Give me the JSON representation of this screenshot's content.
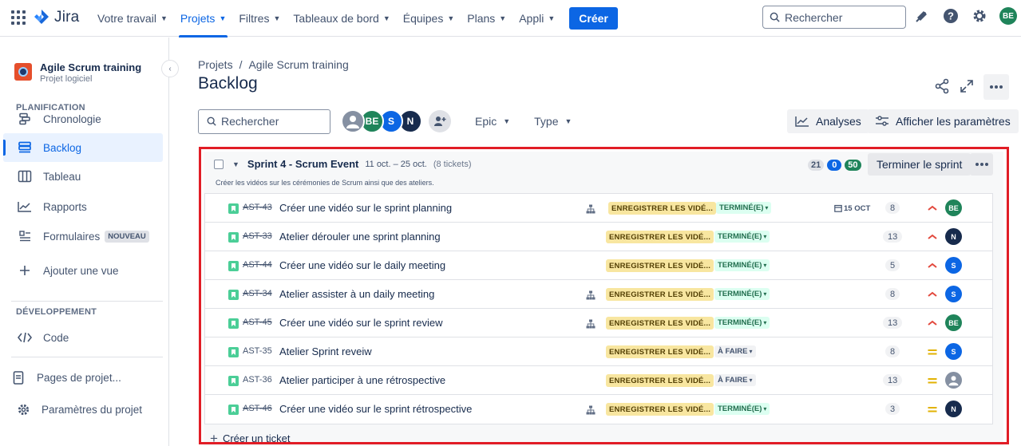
{
  "topnav": {
    "product": "Jira",
    "items": [
      {
        "label": "Votre travail",
        "active": false
      },
      {
        "label": "Projets",
        "active": true
      },
      {
        "label": "Filtres",
        "active": false
      },
      {
        "label": "Tableaux de bord",
        "active": false
      },
      {
        "label": "Équipes",
        "active": false
      },
      {
        "label": "Plans",
        "active": false
      },
      {
        "label": "Appli",
        "active": false
      }
    ],
    "create_label": "Créer",
    "search_placeholder": "Rechercher",
    "user_initials": "BE",
    "icons": [
      "app-switcher-icon",
      "notifications-icon",
      "help-icon",
      "settings-icon"
    ]
  },
  "sidebar": {
    "project_name": "Agile Scrum training",
    "project_type": "Projet logiciel",
    "planning_label": "PLANIFICATION",
    "items": [
      {
        "label": "Chronologie",
        "icon": "timeline-icon"
      },
      {
        "label": "Backlog",
        "icon": "backlog-icon",
        "active": true
      },
      {
        "label": "Tableau",
        "icon": "board-icon"
      },
      {
        "label": "Rapports",
        "icon": "reports-icon"
      },
      {
        "label": "Formulaires",
        "icon": "forms-icon",
        "badge": "NOUVEAU"
      },
      {
        "label": "Ajouter une vue",
        "icon": "plus-icon"
      }
    ],
    "dev_label": "DÉVELOPPEMENT",
    "code_label": "Code",
    "pages_label": "Pages de projet...",
    "settings_label": "Paramètres du projet"
  },
  "page": {
    "breadcrumb": [
      "Projets",
      "Agile Scrum training"
    ],
    "breadcrumb_sep": "/",
    "title": "Backlog"
  },
  "filters": {
    "search_placeholder": "Rechercher",
    "avatars": [
      {
        "initials": "",
        "color": "#8590a2"
      },
      {
        "initials": "BE",
        "color": "#1f845a"
      },
      {
        "initials": "S",
        "color": "#0c66e4"
      },
      {
        "initials": "N",
        "color": "#172b4d"
      }
    ],
    "epic_label": "Epic",
    "type_label": "Type",
    "insights_label": "Analyses",
    "view_settings_label": "Afficher les paramètres"
  },
  "sprint": {
    "name": "Sprint 4 - Scrum Event",
    "dates": "11 oct. – 25 oct.",
    "ticket_count": "(8 tickets)",
    "goal": "Créer les vidéos sur les cérémonies de Scrum ainsi que des ateliers.",
    "points_todo": "21",
    "points_in_progress": "0",
    "points_done": "50",
    "finish_label": "Terminer le sprint",
    "create_ticket_label": "Créer un ticket",
    "colors": {
      "frame": "#e11d26",
      "done_status": "#216e4e",
      "epic": "#f8e6a0"
    },
    "issues": [
      {
        "key": "AST-43",
        "summary": "Créer une vidéo sur le sprint planning",
        "has_children": true,
        "epic": "ENREGISTRER LES VIDÉ...",
        "status": "TERMINÉ(E)",
        "status_type": "done",
        "due": "15 OCT",
        "points": "8",
        "priority": "high",
        "assignee": "BE",
        "assignee_color": "#1f845a"
      },
      {
        "key": "AST-33",
        "summary": "Atelier dérouler une sprint planning",
        "has_children": false,
        "epic": "ENREGISTRER LES VIDÉ...",
        "status": "TERMINÉ(E)",
        "status_type": "done",
        "due": "",
        "points": "13",
        "priority": "high",
        "assignee": "N",
        "assignee_color": "#172b4d"
      },
      {
        "key": "AST-44",
        "summary": "Créer une vidéo sur le daily meeting",
        "has_children": false,
        "epic": "ENREGISTRER LES VIDÉ...",
        "status": "TERMINÉ(E)",
        "status_type": "done",
        "due": "",
        "points": "5",
        "priority": "high",
        "assignee": "S",
        "assignee_color": "#0c66e4"
      },
      {
        "key": "AST-34",
        "summary": "Atelier assister à un daily meeting",
        "has_children": true,
        "epic": "ENREGISTRER LES VIDÉ...",
        "status": "TERMINÉ(E)",
        "status_type": "done",
        "due": "",
        "points": "8",
        "priority": "high",
        "assignee": "S",
        "assignee_color": "#0c66e4"
      },
      {
        "key": "AST-45",
        "summary": "Créer une vidéo sur le sprint review",
        "has_children": true,
        "epic": "ENREGISTRER LES VIDÉ...",
        "status": "TERMINÉ(E)",
        "status_type": "done",
        "due": "",
        "points": "13",
        "priority": "high",
        "assignee": "BE",
        "assignee_color": "#1f845a"
      },
      {
        "key": "AST-35",
        "summary": "Atelier Sprint reveiw",
        "has_children": false,
        "epic": "ENREGISTRER LES VIDÉ...",
        "status": "À FAIRE",
        "status_type": "todo",
        "due": "",
        "points": "8",
        "priority": "medium",
        "assignee": "S",
        "assignee_color": "#0c66e4"
      },
      {
        "key": "AST-36",
        "summary": "Atelier participer à une rétrospective",
        "has_children": false,
        "epic": "ENREGISTRER LES VIDÉ...",
        "status": "À FAIRE",
        "status_type": "todo",
        "due": "",
        "points": "13",
        "priority": "medium",
        "assignee": "",
        "assignee_color": "#8590a2"
      },
      {
        "key": "AST-46",
        "summary": "Créer une vidéo sur le sprint rétrospective",
        "has_children": true,
        "epic": "ENREGISTRER LES VIDÉ...",
        "status": "TERMINÉ(E)",
        "status_type": "done",
        "due": "",
        "points": "3",
        "priority": "medium",
        "assignee": "N",
        "assignee_color": "#172b4d"
      }
    ]
  }
}
